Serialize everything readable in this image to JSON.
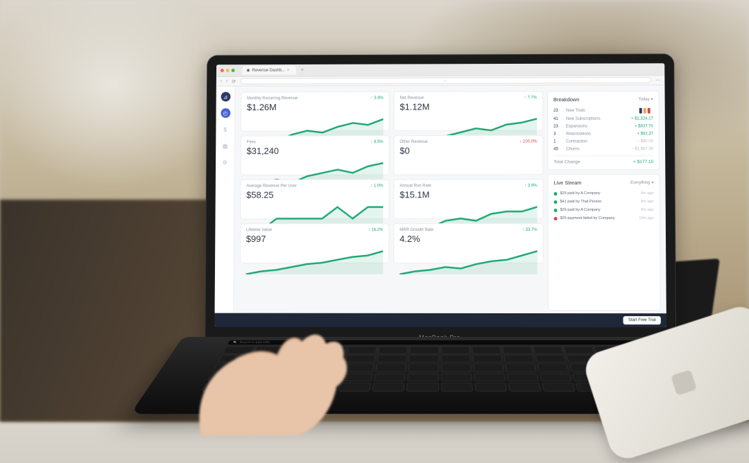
{
  "browser": {
    "tab_title": "Revenue Dashb...",
    "url_hint": "⌂"
  },
  "laptop_model": "MacBook Pro",
  "touchbar_hint": "Search or type URL",
  "sidebar": {
    "items": [
      "logo",
      "chart",
      "money",
      "grid",
      "settings"
    ]
  },
  "metrics": [
    {
      "title": "Monthly Recurring Revenue",
      "value": "$1.26M",
      "delta": "3.9%",
      "dir": "up",
      "spark": [
        12,
        14,
        13,
        16,
        18,
        17,
        20,
        22,
        21,
        24
      ]
    },
    {
      "title": "Net Revenue",
      "value": "$1.12M",
      "delta": "7.7%",
      "dir": "up",
      "spark": [
        9,
        11,
        12,
        12,
        14,
        16,
        15,
        18,
        19,
        21
      ]
    },
    {
      "title": "Fees",
      "value": "$31,240",
      "delta": "8.5%",
      "dir": "up",
      "spark": [
        8,
        9,
        10,
        9,
        11,
        12,
        13,
        12,
        14,
        15
      ]
    },
    {
      "title": "Other Revenue",
      "value": "$0",
      "delta": "100.0%",
      "dir": "down",
      "spark": [
        2,
        2,
        2,
        2,
        2,
        2,
        2,
        2,
        2,
        2
      ]
    },
    {
      "title": "Average Revenue Per User",
      "value": "$58.25",
      "delta": "1.0%",
      "dir": "up",
      "spark": [
        14,
        14,
        15,
        15,
        15,
        15,
        16,
        15,
        16,
        16
      ]
    },
    {
      "title": "Annual Run Rate",
      "value": "$15.1M",
      "delta": "3.9%",
      "dir": "up",
      "spark": [
        10,
        12,
        11,
        14,
        15,
        14,
        17,
        18,
        18,
        20
      ]
    },
    {
      "title": "Lifetime Value",
      "value": "$997",
      "delta": "16.2%",
      "dir": "up",
      "spark": [
        6,
        8,
        9,
        11,
        13,
        14,
        16,
        18,
        19,
        22
      ]
    },
    {
      "title": "MRR Growth Rate",
      "value": "4.2%",
      "delta": "33.7%",
      "dir": "up",
      "spark": [
        4,
        6,
        7,
        9,
        8,
        11,
        13,
        14,
        17,
        20
      ]
    }
  ],
  "breakdown": {
    "title": "Breakdown",
    "range": "Today",
    "rows": [
      {
        "count": "23",
        "label": "New Trials",
        "amount": "",
        "neg": false,
        "minis": [
          "#2b3a67",
          "#f2a54a",
          "#d0474c"
        ]
      },
      {
        "count": "41",
        "label": "New Subscriptions",
        "amount": "+ $1,324.17",
        "neg": false
      },
      {
        "count": "23",
        "label": "Expansions",
        "amount": "+ $837.70",
        "neg": false
      },
      {
        "count": "3",
        "label": "Reactivations",
        "amount": "+ $92.37",
        "neg": false
      },
      {
        "count": "1",
        "label": "Contraction",
        "amount": "- $90.00",
        "neg": true
      },
      {
        "count": "45",
        "label": "Churns",
        "amount": "- $1,987.09",
        "neg": true
      }
    ],
    "total_label": "Total Change",
    "total_value": "+ $177.15"
  },
  "livestream": {
    "title": "Live Stream",
    "filter": "Everything",
    "rows": [
      {
        "status": "g",
        "text": "$29 paid by A Company",
        "time": "6m ago"
      },
      {
        "status": "g",
        "text": "$41 paid by That Person",
        "time": "8m ago"
      },
      {
        "status": "g",
        "text": "$29 paid by A Company",
        "time": "8m ago"
      },
      {
        "status": "r",
        "text": "$29 payment failed by Company",
        "time": "10m ago"
      }
    ]
  },
  "cta": "Start Free Trial",
  "chart_data": {
    "type": "line",
    "note": "sparkline series per metric card; y-values relative (no axis shown)",
    "series": [
      {
        "name": "Monthly Recurring Revenue",
        "values": [
          12,
          14,
          13,
          16,
          18,
          17,
          20,
          22,
          21,
          24
        ]
      },
      {
        "name": "Net Revenue",
        "values": [
          9,
          11,
          12,
          12,
          14,
          16,
          15,
          18,
          19,
          21
        ]
      },
      {
        "name": "Fees",
        "values": [
          8,
          9,
          10,
          9,
          11,
          12,
          13,
          12,
          14,
          15
        ]
      },
      {
        "name": "Other Revenue",
        "values": [
          2,
          2,
          2,
          2,
          2,
          2,
          2,
          2,
          2,
          2
        ]
      },
      {
        "name": "Average Revenue Per User",
        "values": [
          14,
          14,
          15,
          15,
          15,
          15,
          16,
          15,
          16,
          16
        ]
      },
      {
        "name": "Annual Run Rate",
        "values": [
          10,
          12,
          11,
          14,
          15,
          14,
          17,
          18,
          18,
          20
        ]
      },
      {
        "name": "Lifetime Value",
        "values": [
          6,
          8,
          9,
          11,
          13,
          14,
          16,
          18,
          19,
          22
        ]
      },
      {
        "name": "MRR Growth Rate",
        "values": [
          4,
          6,
          7,
          9,
          8,
          11,
          13,
          14,
          17,
          20
        ]
      }
    ]
  }
}
